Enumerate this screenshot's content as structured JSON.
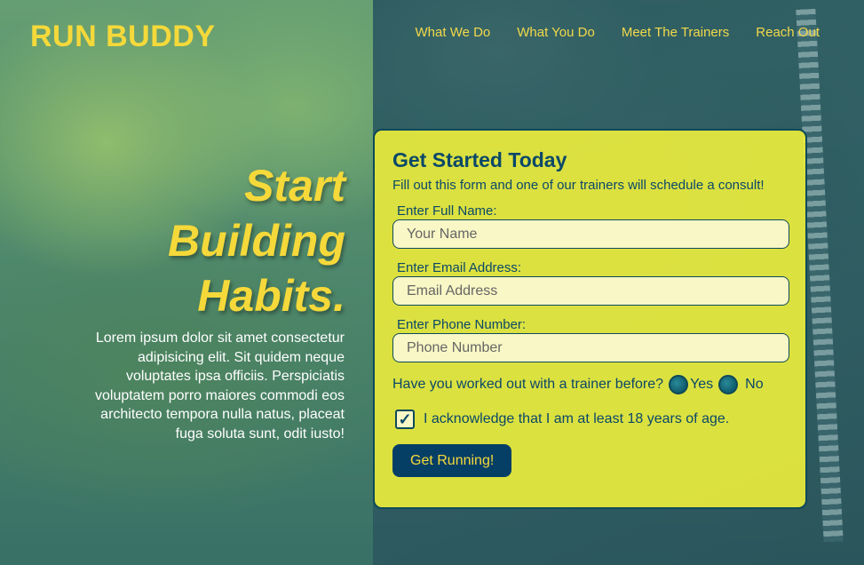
{
  "brand": {
    "name": "RUN BUDDY"
  },
  "nav": {
    "items": [
      "What We Do",
      "What You Do",
      "Meet The Trainers",
      "Reach Out"
    ]
  },
  "hero": {
    "title_lines": [
      "Start",
      "Building",
      "Habits."
    ],
    "body": "Lorem ipsum dolor sit amet consectetur adipisicing elit. Sit quidem neque voluptates ipsa officiis. Perspiciatis voluptatem porro maiores commodi eos architecto tempora nulla natus, placeat fuga soluta sunt, odit iusto!"
  },
  "form": {
    "title": "Get Started Today",
    "subtitle": "Fill out this form and one of our trainers will schedule a consult!",
    "name_label": "Enter Full Name:",
    "name_placeholder": "Your Name",
    "email_label": "Enter Email Address:",
    "email_placeholder": "Email Address",
    "phone_label": "Enter Phone Number:",
    "phone_placeholder": "Phone Number",
    "trainer_question": "Have you worked out with a trainer before?",
    "yes_label": "Yes",
    "no_label": "No",
    "acknowledge_label": "I acknowledge that I am at least 18 years of age.",
    "acknowledge_checked": true,
    "submit_label": "Get Running!"
  },
  "colors": {
    "brand_yellow": "#f5d93a",
    "card_yellow": "#eef03c",
    "dark_blue": "#0b4868",
    "button_bg": "#063f66"
  }
}
